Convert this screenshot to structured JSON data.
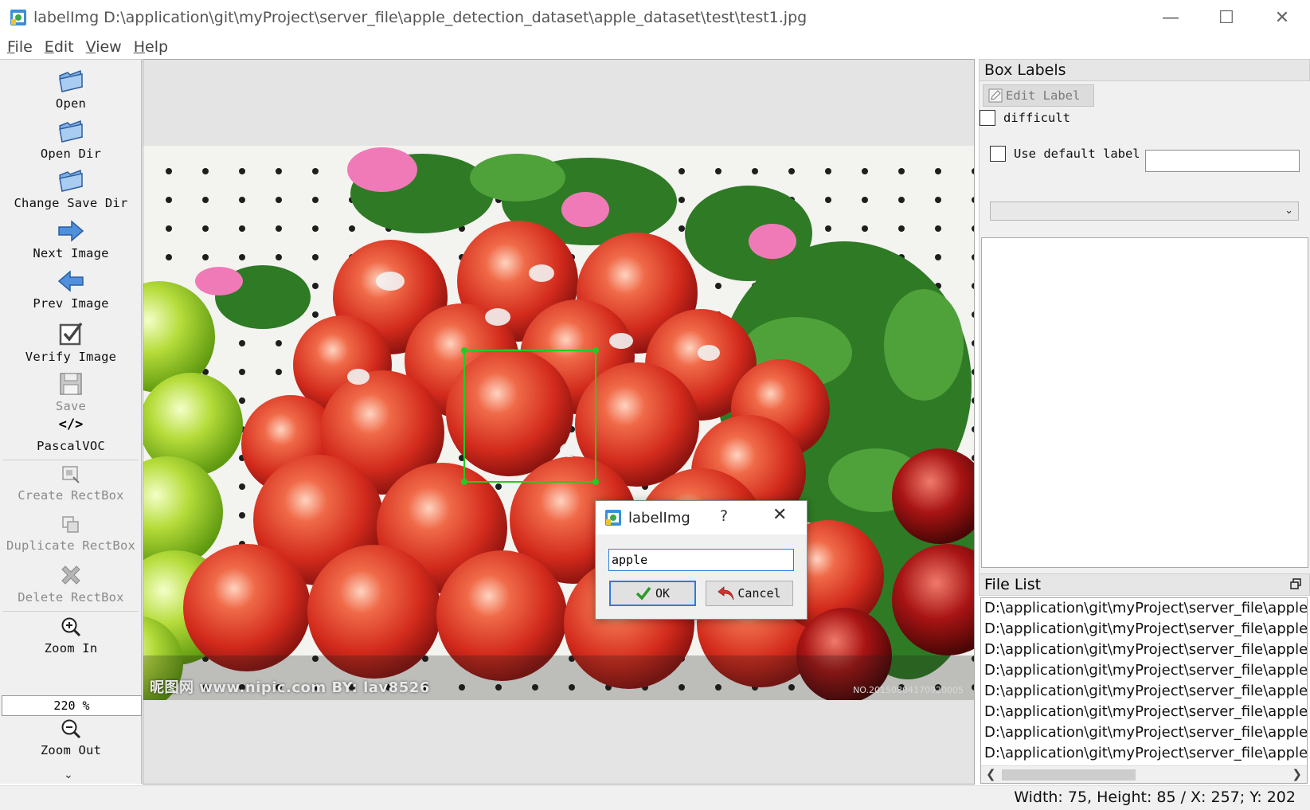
{
  "window": {
    "title": "labelImg D:\\application\\git\\myProject\\server_file\\apple_detection_dataset\\apple_dataset\\test\\test1.jpg",
    "minimize": "—",
    "maximize": "☐",
    "close": "✕"
  },
  "menu": {
    "file_u": "F",
    "file_rest": "ile",
    "edit_u": "E",
    "edit_rest": "dit",
    "view_u": "V",
    "view_rest": "iew",
    "help_u": "H",
    "help_rest": "elp"
  },
  "toolbar": {
    "open": "Open",
    "open_dir": "Open Dir",
    "change_save_dir": "Change Save Dir",
    "next_image": "Next Image",
    "prev_image": "Prev Image",
    "verify_image": "Verify Image",
    "save": "Save",
    "format_icon_text": "</>",
    "format": "PascalVOC",
    "create_rectbox": "Create RectBox",
    "duplicate_rectbox": "Duplicate RectBox",
    "delete_rectbox": "Delete RectBox",
    "zoom_in": "Zoom In",
    "zoom_value": "220 %",
    "zoom_out": "Zoom Out",
    "more": "⌄"
  },
  "canvas": {
    "watermark": "昵图网 www.nipic.com   BY: lav8526",
    "watermark_small": "NO.20150804170920005"
  },
  "dialog": {
    "title": "labelImg",
    "help": "?",
    "close": "✕",
    "input_value": "apple",
    "ok": "OK",
    "cancel": "Cancel"
  },
  "box_labels": {
    "header": "Box Labels",
    "edit_label": "Edit Label",
    "difficult": "difficult",
    "use_default_label": "Use default label",
    "default_label_value": ""
  },
  "file_list": {
    "header": "File List",
    "items": [
      "D:\\application\\git\\myProject\\server_file\\apple_d",
      "D:\\application\\git\\myProject\\server_file\\apple_d",
      "D:\\application\\git\\myProject\\server_file\\apple_d",
      "D:\\application\\git\\myProject\\server_file\\apple_d",
      "D:\\application\\git\\myProject\\server_file\\apple_d",
      "D:\\application\\git\\myProject\\server_file\\apple_d",
      "D:\\application\\git\\myProject\\server_file\\apple_d",
      "D:\\application\\git\\myProject\\server_file\\apple_d"
    ]
  },
  "status": {
    "text": "Width: 75, Height: 85 / X: 257; Y: 202"
  },
  "colors": {
    "bbox": "#22cc22",
    "dialog_focus": "#2d7be0",
    "panel_bg": "#f0f0f0"
  }
}
